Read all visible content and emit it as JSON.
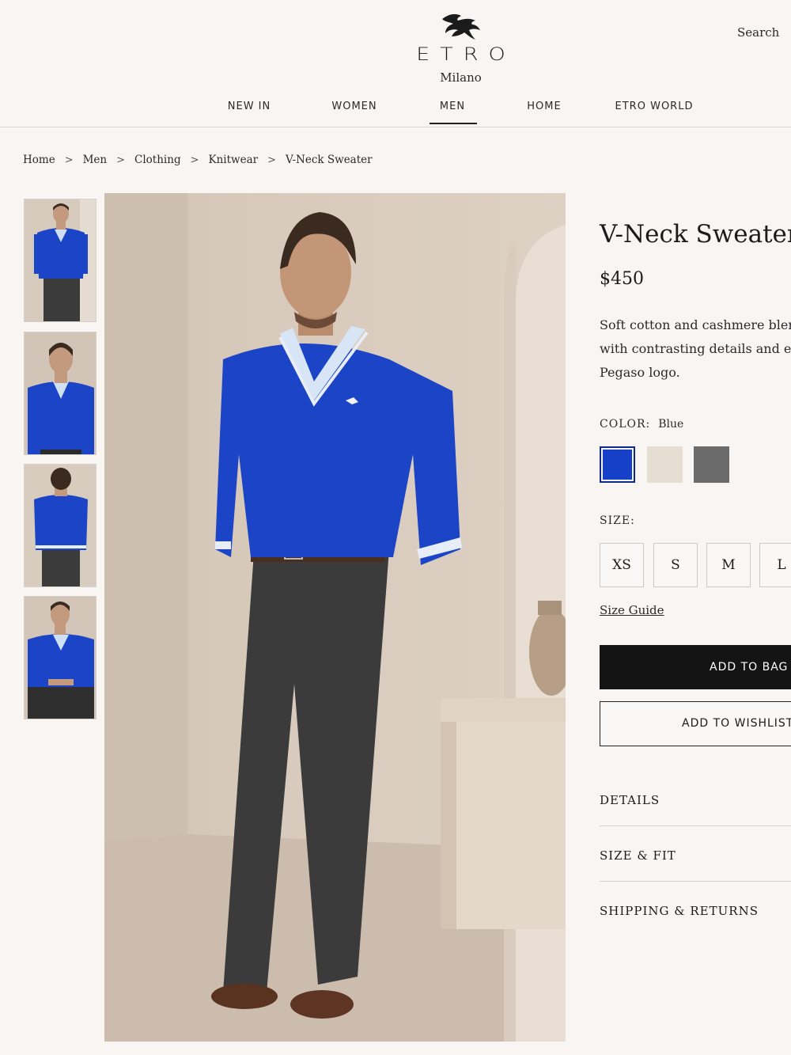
{
  "header": {
    "brand": "ETRO",
    "brand_sub": "Milano",
    "search_label": "Search"
  },
  "nav": {
    "items": [
      {
        "label": "NEW IN"
      },
      {
        "label": "WOMEN"
      },
      {
        "label": "MEN",
        "active": true
      },
      {
        "label": "HOME"
      },
      {
        "label": "ETRO WORLD"
      }
    ]
  },
  "breadcrumb": {
    "items": [
      "Home",
      "Men",
      "Clothing",
      "Knitwear",
      "V-Neck Sweater"
    ],
    "separator": ">"
  },
  "product": {
    "title": "V-Neck Sweater",
    "price": "$450",
    "description_lines": [
      "Soft cotton and cashmere blend",
      "with contrasting details and em",
      "Pegaso logo."
    ],
    "color_label": "COLOR:",
    "color_value": "Blue",
    "swatches": [
      {
        "name": "Blue",
        "hex": "#1640c8",
        "selected": true
      },
      {
        "name": "Beige",
        "hex": "#e6ddd3",
        "selected": false
      },
      {
        "name": "Grey",
        "hex": "#6b6b6b",
        "selected": false
      }
    ],
    "size_label": "SIZE:",
    "sizes": [
      "XS",
      "S",
      "M",
      "L"
    ],
    "size_guide": "Size Guide",
    "add_to_bag": "ADD TO BAG",
    "add_to_wishlist": "ADD TO WISHLIST",
    "accordions": [
      "DETAILS",
      "SIZE & FIT",
      "SHIPPING & RETURNS"
    ]
  },
  "colors": {
    "page_bg": "#f8f5f2",
    "sweater": "#1c44c6",
    "trousers": "#3a3a3a",
    "button_dark": "#141414"
  }
}
